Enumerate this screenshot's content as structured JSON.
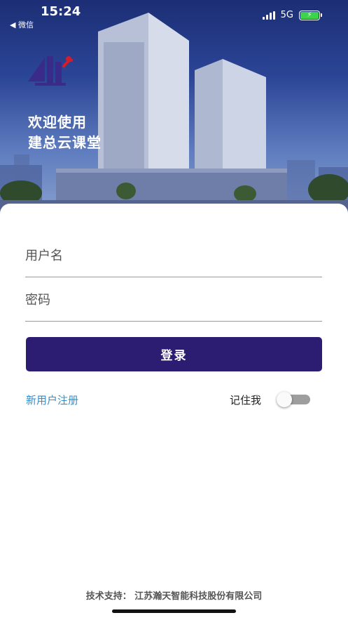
{
  "status_bar": {
    "time": "15:24",
    "back_app": "◀ 微信",
    "network": "5G",
    "battery_icon": "battery-charging-icon"
  },
  "header": {
    "logo_icon": "company-logo",
    "welcome_line1": "欢迎使用",
    "welcome_line2": "建总云课堂"
  },
  "form": {
    "username_placeholder": "用户名",
    "password_placeholder": "密码",
    "login_label": "登录",
    "register_label": "新用户注册",
    "remember_label": "记住我",
    "remember_on": false
  },
  "footer": {
    "support_text": "技术支持：  江苏瀚天智能科技股份有限公司"
  },
  "colors": {
    "primary": "#2c1c72",
    "link": "#2f8fcf",
    "battery": "#3ed34d"
  }
}
